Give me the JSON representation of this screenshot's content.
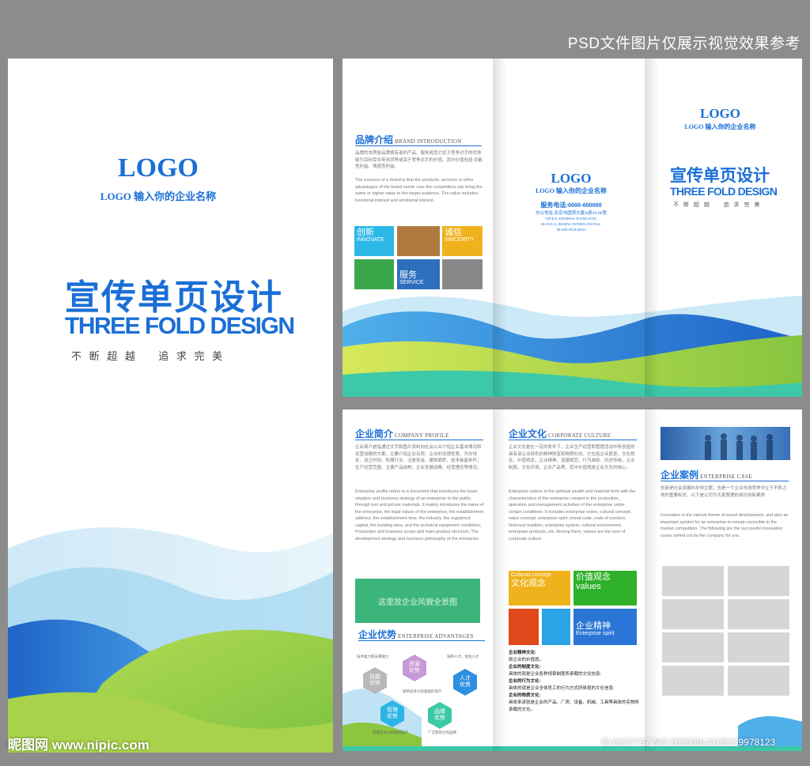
{
  "top_note": "PSD文件图片仅展示视觉效果参考",
  "cover": {
    "logo": "LOGO",
    "company": "LOGO 输入你的企业名称",
    "title_cn": "宣传单页设计",
    "title_en": "THREE FOLD DESIGN",
    "slogan": "不 断 超 越    追 求 完 美"
  },
  "brand": {
    "title": "品牌介绍",
    "title_en": "BRAND INTRODUCTION",
    "text_cn": "品牌的本质是品牌拥有者的产品、服务或其它优于竞争对手的优势能为目标受众带去同等或高于竞争对手的价值。其中价值包括:功能性利益、情感性利益。",
    "text_en": "The essence of a brand is that the products, services or other advantages of the brand owner over the competitors can bring the same or higher value to the target audience. The value includes: functional interest and emotional interest.",
    "tiles": [
      {
        "cn": "创新",
        "en": "INNOVATE",
        "color": "#2bb8e6"
      },
      {
        "cn": "",
        "en": "",
        "color": "#b07a3e"
      },
      {
        "cn": "诚信",
        "en": "SINCERITY",
        "color": "#f0b21c"
      },
      {
        "cn": "",
        "en": "",
        "color": "#3aa84a"
      },
      {
        "cn": "服务",
        "en": "SERVICE",
        "color": "#2d6fbd"
      },
      {
        "cn": "",
        "en": "",
        "color": "#888888"
      }
    ]
  },
  "contact": {
    "logo": "LOGO",
    "company": "LOGO 输入你的企业名称",
    "phone": "服务电话:0000-000000",
    "address": "办公地址:北京市国贸大厦A座28-08室",
    "addr_en1": "OFFICE ADDRESS: ROOM 28-08,",
    "addr_en2": "BLOCK A, BEIJING INTERNATIONAL",
    "addr_en3": "TRADE BUILDING"
  },
  "front": {
    "logo": "LOGO",
    "company": "LOGO 输入你的企业名称",
    "title_cn": "宣传单页设计",
    "title_en": "THREE FOLD DESIGN",
    "slogan": "不 断 超 越    追 求 完 美"
  },
  "profile": {
    "title": "企业简介",
    "title_en": "COMPANY PROFILE",
    "text_cn": "企业简介是指通过文字和图片资料向社会公众介绍企业基本情况和经营战略的文案。主要介绍企业名称、企业的法律性质、开办地址、设立时间、所属行业、注册资金、建筑面积、技术装备条件；生产经营范围、主要产品结构；企业发展战略、经营理念等情况。",
    "text_en": "Enterprise profile refers to a document that introduces the basic situation and business strategy of an enterprise to the public through text and picture materials. It mainly introduces the name of the enterprise, the legal nature of the enterprise, the establishment address, the establishment time, the industry, the registered capital, the building area, and the technical equipment conditions; Production and business scope and main product structure; The development strategy and business philosophy of the enterprise.",
    "image_label": "这里放企业风貌全景图"
  },
  "advantages": {
    "title": "企业优势",
    "title_en": "ENTERPRISE ADVANTAGES",
    "items": [
      {
        "label": "技能\n优势",
        "color": "#b8b8b8",
        "note": "技术能力和支撑能力"
      },
      {
        "label": "资源\n优势",
        "color": "#c69ad6",
        "note": "提供竞争力的基础的资产"
      },
      {
        "label": "人才\n优势",
        "color": "#2c8fe0",
        "note": "培养人才，留住人才"
      },
      {
        "label": "管理\n优势",
        "color": "#2bb4e6",
        "note": "获得竞争力基础的资产"
      },
      {
        "label": "品牌\n优势",
        "color": "#3cc9a6",
        "note": "广泛影响力的品牌"
      }
    ]
  },
  "culture": {
    "title": "企业文化",
    "title_en": "CORPORATE CULTURE",
    "text_cn": "企业文化是在一定的条件下，企业生产经营和管理活动中所创造的具有该企业特色的精神财富和物质形态。它包括企业愿景，文化观念，价值观念，企业精神，道德规范，行为准则，历史传统，企业制度，文化环境，企业产品等，其中价值观是企业文化的核心。",
    "text_en": "Enterprise culture is the spiritual wealth and material form with the characteristics of the enterprise created in the production, operation and management activities of the enterprise under certain conditions. It includes enterprise vision, cultural concept, value concept, enterprise spirit, moral code, code of conduct, historical tradition, enterprise system, cultural environment, enterprise products, etc. Among them, values are the core of corporate culture.",
    "tiles": [
      {
        "cn": "文化观念",
        "en": "Cultural concept",
        "color": "#f0b21c"
      },
      {
        "cn": "价值观念",
        "en": "values",
        "color": "#2fb02a"
      },
      {
        "cn": "",
        "en": "",
        "color": "#e04a1c"
      },
      {
        "cn": "",
        "en": "",
        "color": "#2ba4e6"
      },
      {
        "cn": "企业精神",
        "en": "Enterprise spirit",
        "color": "#2b75d6"
      }
    ],
    "list": [
      {
        "h": "企业精神文化:",
        "t": "即企业的价值观。"
      },
      {
        "h": "企业的制度文化:",
        "t": "具体的就是企业各种规章制度所承载的文化信息;"
      },
      {
        "h": "企业的行为文化:",
        "t": "具体的就是企业全体员工的行为方式所体现的文化信息;"
      },
      {
        "h": "企业的物质文化:",
        "t": "具体来讲就是企业的产品、厂房、设备、机械、工具等具体的实物所承载的文化。"
      }
    ]
  },
  "cases": {
    "title": "企业案例",
    "title_en": "ENTERPRISE CASE",
    "text_cn": "创新是社会发展的永恒主题，也是一个企业市场竞争中立于不败之地的重要标志，以下是公司为大家整理的成功创新案例",
    "text_en": "Innovation is the eternal theme of social development, and also an important symbol for an enterprise to remain invincible in the market competition. The following are the successful innovation cases sorted out by the company for you."
  },
  "watermark": "昵图网 www.nipic.com",
  "id_tag": "ID:6237737 NO:20250814105239978123",
  "colors": {
    "accent": "#1a6fd6",
    "green": "#8cc63f"
  }
}
